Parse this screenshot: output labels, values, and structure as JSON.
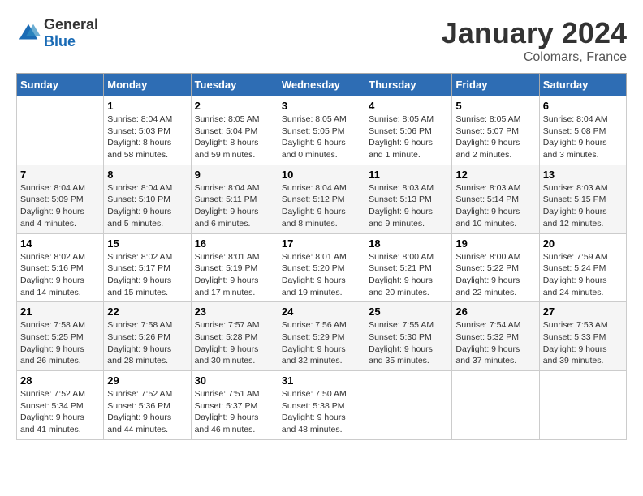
{
  "logo": {
    "text_general": "General",
    "text_blue": "Blue"
  },
  "title": {
    "month": "January 2024",
    "location": "Colomars, France"
  },
  "calendar": {
    "headers": [
      "Sunday",
      "Monday",
      "Tuesday",
      "Wednesday",
      "Thursday",
      "Friday",
      "Saturday"
    ],
    "weeks": [
      [
        {
          "day": "",
          "sunrise": "",
          "sunset": "",
          "daylight": ""
        },
        {
          "day": "1",
          "sunrise": "Sunrise: 8:04 AM",
          "sunset": "Sunset: 5:03 PM",
          "daylight": "Daylight: 8 hours and 58 minutes."
        },
        {
          "day": "2",
          "sunrise": "Sunrise: 8:05 AM",
          "sunset": "Sunset: 5:04 PM",
          "daylight": "Daylight: 8 hours and 59 minutes."
        },
        {
          "day": "3",
          "sunrise": "Sunrise: 8:05 AM",
          "sunset": "Sunset: 5:05 PM",
          "daylight": "Daylight: 9 hours and 0 minutes."
        },
        {
          "day": "4",
          "sunrise": "Sunrise: 8:05 AM",
          "sunset": "Sunset: 5:06 PM",
          "daylight": "Daylight: 9 hours and 1 minute."
        },
        {
          "day": "5",
          "sunrise": "Sunrise: 8:05 AM",
          "sunset": "Sunset: 5:07 PM",
          "daylight": "Daylight: 9 hours and 2 minutes."
        },
        {
          "day": "6",
          "sunrise": "Sunrise: 8:04 AM",
          "sunset": "Sunset: 5:08 PM",
          "daylight": "Daylight: 9 hours and 3 minutes."
        }
      ],
      [
        {
          "day": "7",
          "sunrise": "Sunrise: 8:04 AM",
          "sunset": "Sunset: 5:09 PM",
          "daylight": "Daylight: 9 hours and 4 minutes."
        },
        {
          "day": "8",
          "sunrise": "Sunrise: 8:04 AM",
          "sunset": "Sunset: 5:10 PM",
          "daylight": "Daylight: 9 hours and 5 minutes."
        },
        {
          "day": "9",
          "sunrise": "Sunrise: 8:04 AM",
          "sunset": "Sunset: 5:11 PM",
          "daylight": "Daylight: 9 hours and 6 minutes."
        },
        {
          "day": "10",
          "sunrise": "Sunrise: 8:04 AM",
          "sunset": "Sunset: 5:12 PM",
          "daylight": "Daylight: 9 hours and 8 minutes."
        },
        {
          "day": "11",
          "sunrise": "Sunrise: 8:03 AM",
          "sunset": "Sunset: 5:13 PM",
          "daylight": "Daylight: 9 hours and 9 minutes."
        },
        {
          "day": "12",
          "sunrise": "Sunrise: 8:03 AM",
          "sunset": "Sunset: 5:14 PM",
          "daylight": "Daylight: 9 hours and 10 minutes."
        },
        {
          "day": "13",
          "sunrise": "Sunrise: 8:03 AM",
          "sunset": "Sunset: 5:15 PM",
          "daylight": "Daylight: 9 hours and 12 minutes."
        }
      ],
      [
        {
          "day": "14",
          "sunrise": "Sunrise: 8:02 AM",
          "sunset": "Sunset: 5:16 PM",
          "daylight": "Daylight: 9 hours and 14 minutes."
        },
        {
          "day": "15",
          "sunrise": "Sunrise: 8:02 AM",
          "sunset": "Sunset: 5:17 PM",
          "daylight": "Daylight: 9 hours and 15 minutes."
        },
        {
          "day": "16",
          "sunrise": "Sunrise: 8:01 AM",
          "sunset": "Sunset: 5:19 PM",
          "daylight": "Daylight: 9 hours and 17 minutes."
        },
        {
          "day": "17",
          "sunrise": "Sunrise: 8:01 AM",
          "sunset": "Sunset: 5:20 PM",
          "daylight": "Daylight: 9 hours and 19 minutes."
        },
        {
          "day": "18",
          "sunrise": "Sunrise: 8:00 AM",
          "sunset": "Sunset: 5:21 PM",
          "daylight": "Daylight: 9 hours and 20 minutes."
        },
        {
          "day": "19",
          "sunrise": "Sunrise: 8:00 AM",
          "sunset": "Sunset: 5:22 PM",
          "daylight": "Daylight: 9 hours and 22 minutes."
        },
        {
          "day": "20",
          "sunrise": "Sunrise: 7:59 AM",
          "sunset": "Sunset: 5:24 PM",
          "daylight": "Daylight: 9 hours and 24 minutes."
        }
      ],
      [
        {
          "day": "21",
          "sunrise": "Sunrise: 7:58 AM",
          "sunset": "Sunset: 5:25 PM",
          "daylight": "Daylight: 9 hours and 26 minutes."
        },
        {
          "day": "22",
          "sunrise": "Sunrise: 7:58 AM",
          "sunset": "Sunset: 5:26 PM",
          "daylight": "Daylight: 9 hours and 28 minutes."
        },
        {
          "day": "23",
          "sunrise": "Sunrise: 7:57 AM",
          "sunset": "Sunset: 5:28 PM",
          "daylight": "Daylight: 9 hours and 30 minutes."
        },
        {
          "day": "24",
          "sunrise": "Sunrise: 7:56 AM",
          "sunset": "Sunset: 5:29 PM",
          "daylight": "Daylight: 9 hours and 32 minutes."
        },
        {
          "day": "25",
          "sunrise": "Sunrise: 7:55 AM",
          "sunset": "Sunset: 5:30 PM",
          "daylight": "Daylight: 9 hours and 35 minutes."
        },
        {
          "day": "26",
          "sunrise": "Sunrise: 7:54 AM",
          "sunset": "Sunset: 5:32 PM",
          "daylight": "Daylight: 9 hours and 37 minutes."
        },
        {
          "day": "27",
          "sunrise": "Sunrise: 7:53 AM",
          "sunset": "Sunset: 5:33 PM",
          "daylight": "Daylight: 9 hours and 39 minutes."
        }
      ],
      [
        {
          "day": "28",
          "sunrise": "Sunrise: 7:52 AM",
          "sunset": "Sunset: 5:34 PM",
          "daylight": "Daylight: 9 hours and 41 minutes."
        },
        {
          "day": "29",
          "sunrise": "Sunrise: 7:52 AM",
          "sunset": "Sunset: 5:36 PM",
          "daylight": "Daylight: 9 hours and 44 minutes."
        },
        {
          "day": "30",
          "sunrise": "Sunrise: 7:51 AM",
          "sunset": "Sunset: 5:37 PM",
          "daylight": "Daylight: 9 hours and 46 minutes."
        },
        {
          "day": "31",
          "sunrise": "Sunrise: 7:50 AM",
          "sunset": "Sunset: 5:38 PM",
          "daylight": "Daylight: 9 hours and 48 minutes."
        },
        {
          "day": "",
          "sunrise": "",
          "sunset": "",
          "daylight": ""
        },
        {
          "day": "",
          "sunrise": "",
          "sunset": "",
          "daylight": ""
        },
        {
          "day": "",
          "sunrise": "",
          "sunset": "",
          "daylight": ""
        }
      ]
    ]
  }
}
